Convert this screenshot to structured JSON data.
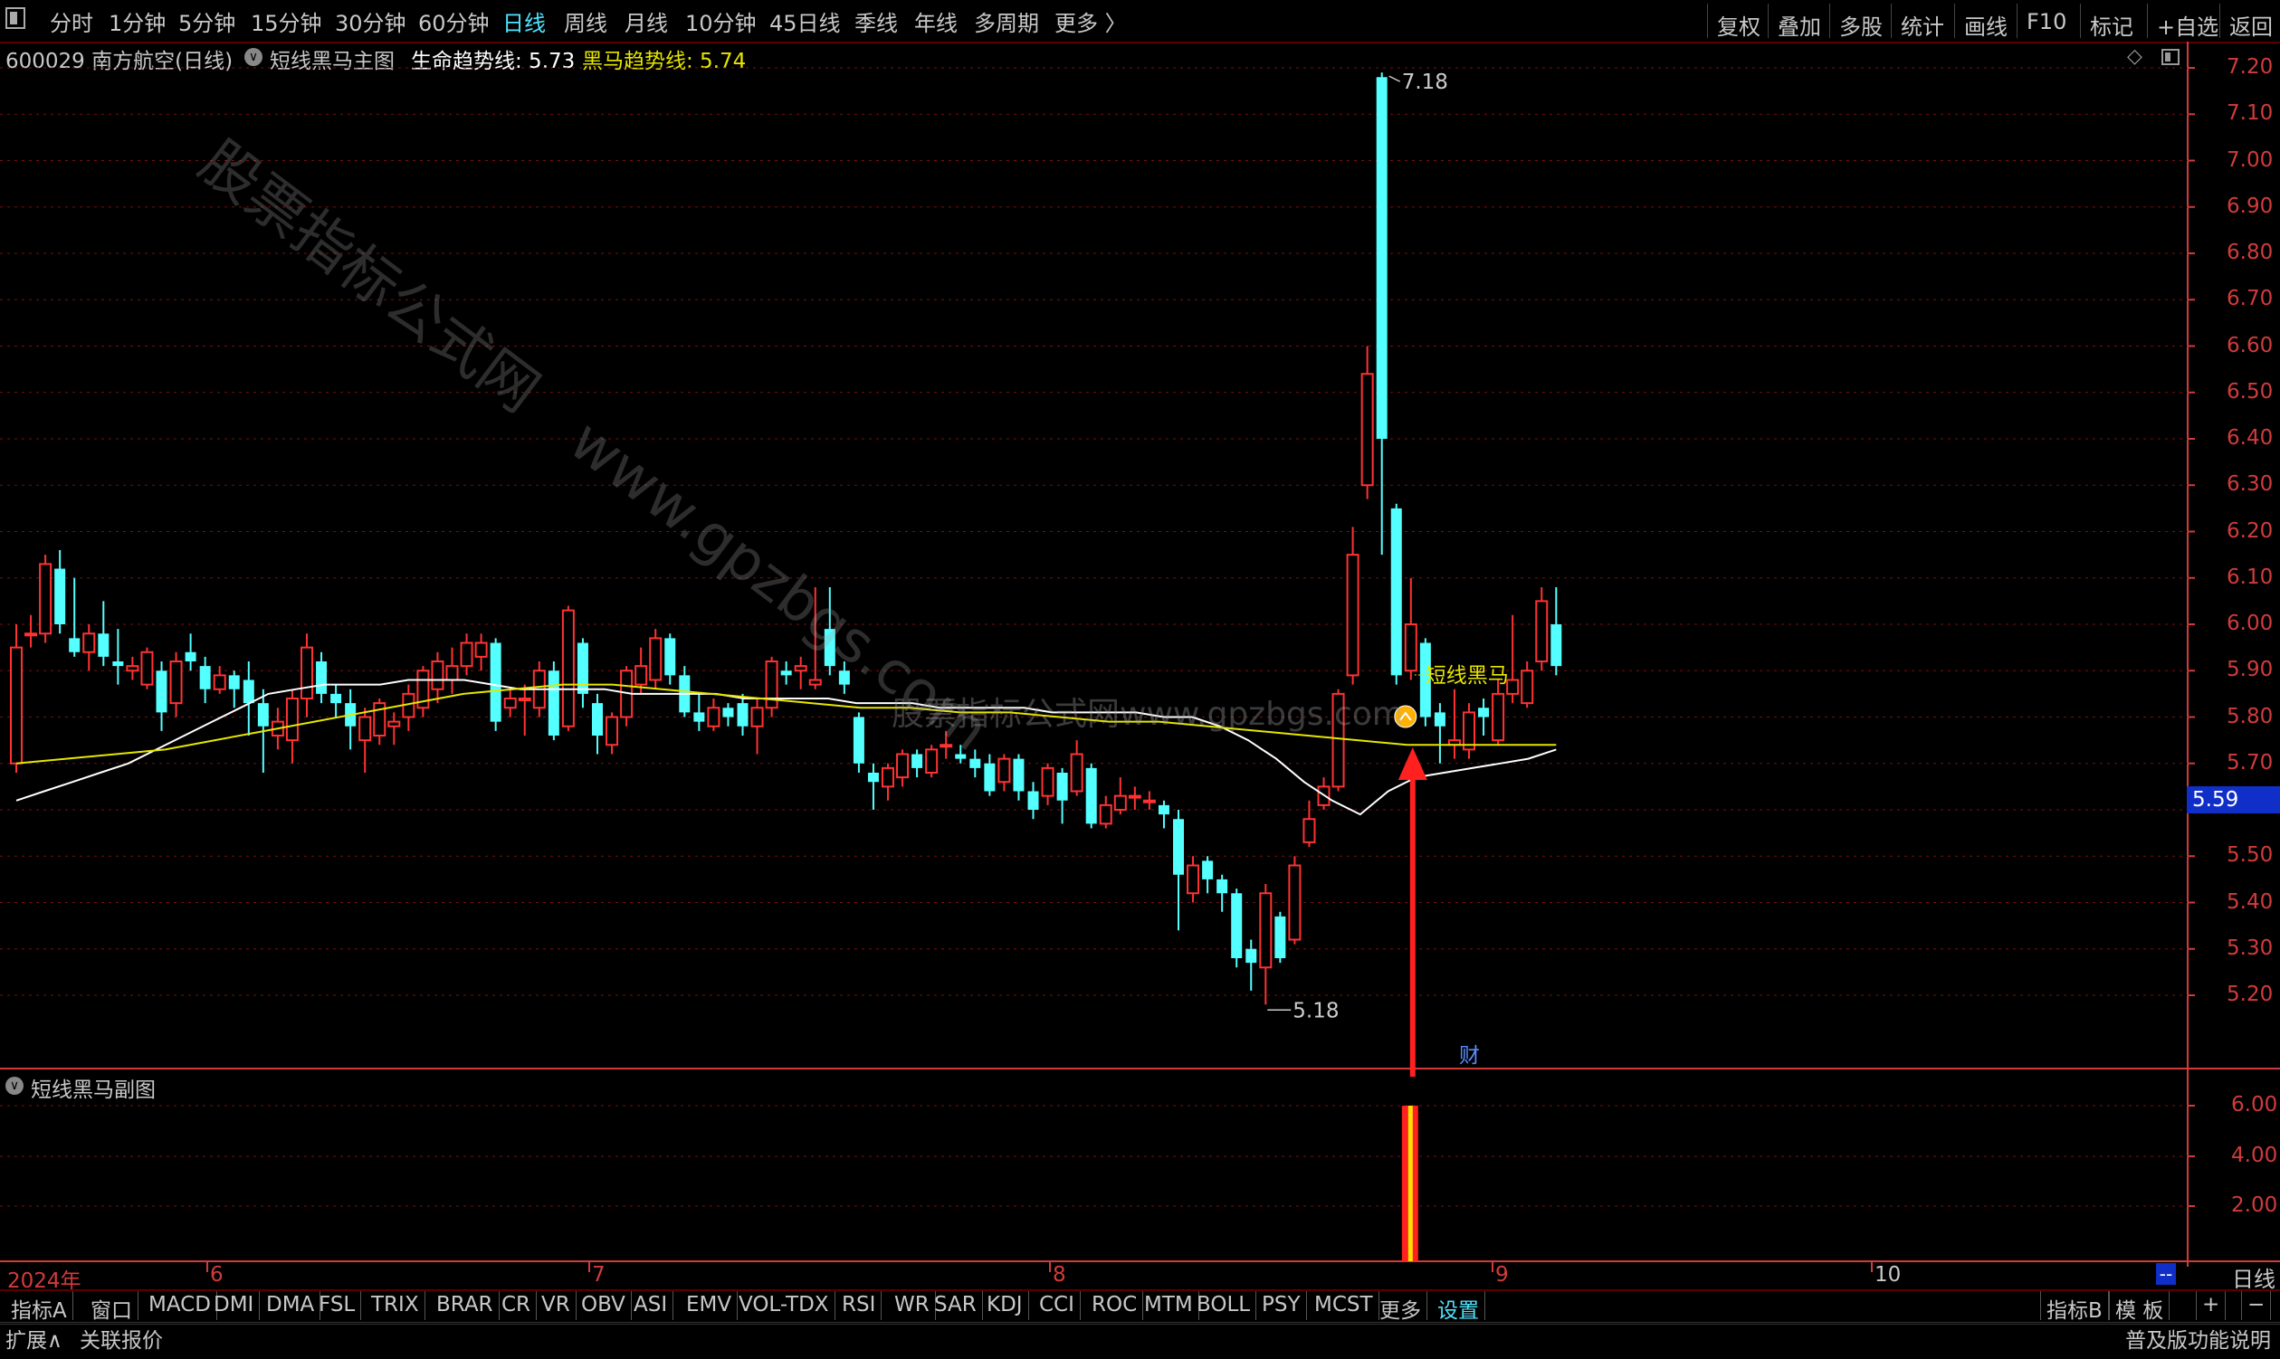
{
  "topbar": {
    "periods": [
      "分时",
      "1分钟",
      "5分钟",
      "15分钟",
      "30分钟",
      "60分钟",
      "日线",
      "周线",
      "月线",
      "10分钟",
      "45日线",
      "季线",
      "年线",
      "多周期",
      "更多 〉"
    ],
    "active_period": "日线",
    "right_buttons": [
      "复权",
      "叠加",
      "多股",
      "统计",
      "画线",
      "F10",
      "标记",
      "+自选",
      "返回"
    ]
  },
  "info": {
    "stock": "600029 南方航空(日线)",
    "indicator_name": "短线黑马主图",
    "life_line_label": "生命趋势线: 5.73",
    "horse_line_label": "黑马趋势线: 5.74"
  },
  "chart": {
    "price_ticks": [
      "7.20",
      "7.10",
      "7.00",
      "6.90",
      "6.80",
      "6.70",
      "6.60",
      "6.50",
      "6.40",
      "6.30",
      "6.20",
      "6.10",
      "6.00",
      "5.90",
      "5.80",
      "5.70",
      "5.50",
      "5.40",
      "5.30",
      "5.20"
    ],
    "current_price": "5.59",
    "high_label": "7.18",
    "low_label": "5.18",
    "signal_label": "短线黑马",
    "fin_marker": "财",
    "watermark_1": "股票指标公式网",
    "watermark_2": "www.gpzbgs.com",
    "watermark_3": "股票指标公式网www.gpzbgs.com",
    "x_ticks": [
      "2024年",
      "6",
      "7",
      "8",
      "9",
      "10"
    ],
    "period_label": "日线",
    "scroll_label": "--"
  },
  "sub_chart": {
    "title": "短线黑马副图",
    "ticks": [
      "6.00",
      "4.00",
      "2.00"
    ]
  },
  "indicator_tabs": [
    "指标A",
    "窗口",
    "MACD",
    "DMI",
    "DMA",
    "FSL",
    "TRIX",
    "BRAR",
    "CR",
    "VR",
    "OBV",
    "ASI",
    "EMV",
    "VOL-TDX",
    "RSI",
    "WR",
    "SAR",
    "KDJ",
    "CCI",
    "ROC",
    "MTM",
    "BOLL",
    "PSY",
    "MCST",
    "更多",
    "设置"
  ],
  "active_tab": "设置",
  "right_tabs": [
    "指标B",
    "模 板",
    "+",
    "−"
  ],
  "footer": {
    "expand": "扩展∧",
    "quote": "关联报价",
    "help": "普及版功能说明"
  },
  "colors": {
    "up": "#ff3232",
    "down": "#54ffff",
    "life_line": "#ffffff",
    "horse_line": "#e6e600",
    "axis": "#d23b3b",
    "grid": "#7a1010",
    "active": "#4fe3ff"
  },
  "chart_data": {
    "type": "candlestick",
    "series": [
      {
        "o": 5.7,
        "c": 5.95,
        "h": 6.0,
        "l": 5.68
      },
      {
        "o": 5.98,
        "c": 5.98,
        "h": 6.02,
        "l": 5.95
      },
      {
        "o": 5.98,
        "c": 6.13,
        "h": 6.15,
        "l": 5.96
      },
      {
        "o": 6.12,
        "c": 6.0,
        "h": 6.16,
        "l": 5.98
      },
      {
        "o": 5.97,
        "c": 5.94,
        "h": 6.1,
        "l": 5.93
      },
      {
        "o": 5.94,
        "c": 5.98,
        "h": 6.0,
        "l": 5.9
      },
      {
        "o": 5.98,
        "c": 5.93,
        "h": 6.05,
        "l": 5.91
      },
      {
        "o": 5.92,
        "c": 5.91,
        "h": 5.99,
        "l": 5.87
      },
      {
        "o": 5.9,
        "c": 5.91,
        "h": 5.93,
        "l": 5.88
      },
      {
        "o": 5.87,
        "c": 5.94,
        "h": 5.95,
        "l": 5.86
      },
      {
        "o": 5.9,
        "c": 5.81,
        "h": 5.92,
        "l": 5.77
      },
      {
        "o": 5.83,
        "c": 5.92,
        "h": 5.94,
        "l": 5.8
      },
      {
        "o": 5.94,
        "c": 5.92,
        "h": 5.98,
        "l": 5.9
      },
      {
        "o": 5.91,
        "c": 5.86,
        "h": 5.93,
        "l": 5.83
      },
      {
        "o": 5.86,
        "c": 5.89,
        "h": 5.91,
        "l": 5.85
      },
      {
        "o": 5.89,
        "c": 5.86,
        "h": 5.9,
        "l": 5.82
      },
      {
        "o": 5.88,
        "c": 5.83,
        "h": 5.92,
        "l": 5.76
      },
      {
        "o": 5.83,
        "c": 5.78,
        "h": 5.86,
        "l": 5.68
      },
      {
        "o": 5.76,
        "c": 5.79,
        "h": 5.82,
        "l": 5.73
      },
      {
        "o": 5.75,
        "c": 5.84,
        "h": 5.86,
        "l": 5.7
      },
      {
        "o": 5.84,
        "c": 5.95,
        "h": 5.98,
        "l": 5.8
      },
      {
        "o": 5.92,
        "c": 5.85,
        "h": 5.94,
        "l": 5.83
      },
      {
        "o": 5.85,
        "c": 5.83,
        "h": 5.87,
        "l": 5.8
      },
      {
        "o": 5.83,
        "c": 5.78,
        "h": 5.86,
        "l": 5.73
      },
      {
        "o": 5.75,
        "c": 5.8,
        "h": 5.82,
        "l": 5.68
      },
      {
        "o": 5.76,
        "c": 5.83,
        "h": 5.84,
        "l": 5.74
      },
      {
        "o": 5.78,
        "c": 5.79,
        "h": 5.81,
        "l": 5.74
      },
      {
        "o": 5.8,
        "c": 5.85,
        "h": 5.87,
        "l": 5.77
      },
      {
        "o": 5.82,
        "c": 5.9,
        "h": 5.91,
        "l": 5.8
      },
      {
        "o": 5.86,
        "c": 5.92,
        "h": 5.94,
        "l": 5.83
      },
      {
        "o": 5.88,
        "c": 5.91,
        "h": 5.95,
        "l": 5.85
      },
      {
        "o": 5.91,
        "c": 5.96,
        "h": 5.98,
        "l": 5.89
      },
      {
        "o": 5.93,
        "c": 5.96,
        "h": 5.98,
        "l": 5.9
      },
      {
        "o": 5.96,
        "c": 5.79,
        "h": 5.97,
        "l": 5.77
      },
      {
        "o": 5.82,
        "c": 5.84,
        "h": 5.86,
        "l": 5.8
      },
      {
        "o": 5.84,
        "c": 5.84,
        "h": 5.87,
        "l": 5.76
      },
      {
        "o": 5.82,
        "c": 5.9,
        "h": 5.92,
        "l": 5.8
      },
      {
        "o": 5.9,
        "c": 5.76,
        "h": 5.92,
        "l": 5.75
      },
      {
        "o": 5.78,
        "c": 6.03,
        "h": 6.04,
        "l": 5.77
      },
      {
        "o": 5.96,
        "c": 5.85,
        "h": 5.97,
        "l": 5.82
      },
      {
        "o": 5.83,
        "c": 5.76,
        "h": 5.85,
        "l": 5.72
      },
      {
        "o": 5.74,
        "c": 5.8,
        "h": 5.81,
        "l": 5.72
      },
      {
        "o": 5.8,
        "c": 5.9,
        "h": 5.91,
        "l": 5.78
      },
      {
        "o": 5.87,
        "c": 5.91,
        "h": 5.95,
        "l": 5.85
      },
      {
        "o": 5.88,
        "c": 5.97,
        "h": 5.99,
        "l": 5.86
      },
      {
        "o": 5.97,
        "c": 5.89,
        "h": 5.98,
        "l": 5.87
      },
      {
        "o": 5.89,
        "c": 5.81,
        "h": 5.91,
        "l": 5.8
      },
      {
        "o": 5.81,
        "c": 5.79,
        "h": 5.85,
        "l": 5.77
      },
      {
        "o": 5.78,
        "c": 5.82,
        "h": 5.84,
        "l": 5.77
      },
      {
        "o": 5.82,
        "c": 5.8,
        "h": 5.83,
        "l": 5.78
      },
      {
        "o": 5.83,
        "c": 5.78,
        "h": 5.85,
        "l": 5.76
      },
      {
        "o": 5.78,
        "c": 5.82,
        "h": 5.84,
        "l": 5.72
      },
      {
        "o": 5.82,
        "c": 5.92,
        "h": 5.93,
        "l": 5.8
      },
      {
        "o": 5.9,
        "c": 5.89,
        "h": 5.92,
        "l": 5.87
      },
      {
        "o": 5.9,
        "c": 5.91,
        "h": 5.93,
        "l": 5.86
      },
      {
        "o": 5.87,
        "c": 5.88,
        "h": 6.08,
        "l": 5.86
      },
      {
        "o": 5.99,
        "c": 5.91,
        "h": 6.08,
        "l": 5.89
      },
      {
        "o": 5.9,
        "c": 5.87,
        "h": 5.92,
        "l": 5.85
      },
      {
        "o": 5.8,
        "c": 5.7,
        "h": 5.81,
        "l": 5.68
      },
      {
        "o": 5.68,
        "c": 5.66,
        "h": 5.7,
        "l": 5.6
      },
      {
        "o": 5.65,
        "c": 5.69,
        "h": 5.7,
        "l": 5.62
      },
      {
        "o": 5.67,
        "c": 5.72,
        "h": 5.73,
        "l": 5.65
      },
      {
        "o": 5.72,
        "c": 5.69,
        "h": 5.73,
        "l": 5.67
      },
      {
        "o": 5.68,
        "c": 5.73,
        "h": 5.74,
        "l": 5.67
      },
      {
        "o": 5.74,
        "c": 5.74,
        "h": 5.77,
        "l": 5.71
      },
      {
        "o": 5.72,
        "c": 5.71,
        "h": 5.74,
        "l": 5.7
      },
      {
        "o": 5.71,
        "c": 5.69,
        "h": 5.73,
        "l": 5.67
      },
      {
        "o": 5.7,
        "c": 5.64,
        "h": 5.72,
        "l": 5.63
      },
      {
        "o": 5.66,
        "c": 5.71,
        "h": 5.72,
        "l": 5.64
      },
      {
        "o": 5.71,
        "c": 5.64,
        "h": 5.72,
        "l": 5.62
      },
      {
        "o": 5.64,
        "c": 5.6,
        "h": 5.66,
        "l": 5.58
      },
      {
        "o": 5.63,
        "c": 5.69,
        "h": 5.7,
        "l": 5.61
      },
      {
        "o": 5.68,
        "c": 5.62,
        "h": 5.69,
        "l": 5.57
      },
      {
        "o": 5.64,
        "c": 5.72,
        "h": 5.75,
        "l": 5.63
      },
      {
        "o": 5.69,
        "c": 5.57,
        "h": 5.7,
        "l": 5.56
      },
      {
        "o": 5.57,
        "c": 5.61,
        "h": 5.63,
        "l": 5.56
      },
      {
        "o": 5.6,
        "c": 5.63,
        "h": 5.67,
        "l": 5.59
      },
      {
        "o": 5.63,
        "c": 5.63,
        "h": 5.65,
        "l": 5.6
      },
      {
        "o": 5.62,
        "c": 5.62,
        "h": 5.64,
        "l": 5.6
      },
      {
        "o": 5.61,
        "c": 5.59,
        "h": 5.62,
        "l": 5.56
      },
      {
        "o": 5.58,
        "c": 5.46,
        "h": 5.6,
        "l": 5.34
      },
      {
        "o": 5.42,
        "c": 5.48,
        "h": 5.5,
        "l": 5.4
      },
      {
        "o": 5.49,
        "c": 5.45,
        "h": 5.5,
        "l": 5.42
      },
      {
        "o": 5.45,
        "c": 5.42,
        "h": 5.46,
        "l": 5.38
      },
      {
        "o": 5.42,
        "c": 5.28,
        "h": 5.43,
        "l": 5.26
      },
      {
        "o": 5.3,
        "c": 5.27,
        "h": 5.32,
        "l": 5.21
      },
      {
        "o": 5.26,
        "c": 5.42,
        "h": 5.44,
        "l": 5.18
      },
      {
        "o": 5.37,
        "c": 5.28,
        "h": 5.38,
        "l": 5.27
      },
      {
        "o": 5.32,
        "c": 5.48,
        "h": 5.5,
        "l": 5.31
      },
      {
        "o": 5.53,
        "c": 5.58,
        "h": 5.62,
        "l": 5.52
      },
      {
        "o": 5.61,
        "c": 5.65,
        "h": 5.67,
        "l": 5.6
      },
      {
        "o": 5.65,
        "c": 5.85,
        "h": 5.86,
        "l": 5.64
      },
      {
        "o": 5.89,
        "c": 6.15,
        "h": 6.21,
        "l": 5.87
      },
      {
        "o": 6.3,
        "c": 6.54,
        "h": 6.6,
        "l": 6.27
      },
      {
        "o": 7.18,
        "c": 6.4,
        "h": 7.19,
        "l": 6.15
      },
      {
        "o": 6.25,
        "c": 5.89,
        "h": 6.26,
        "l": 5.87
      },
      {
        "o": 5.9,
        "c": 6.0,
        "h": 6.1,
        "l": 5.88
      },
      {
        "o": 5.96,
        "c": 5.8,
        "h": 5.97,
        "l": 5.78
      },
      {
        "o": 5.81,
        "c": 5.78,
        "h": 5.83,
        "l": 5.7
      },
      {
        "o": 5.74,
        "c": 5.75,
        "h": 5.86,
        "l": 5.71
      },
      {
        "o": 5.73,
        "c": 5.81,
        "h": 5.83,
        "l": 5.71
      },
      {
        "o": 5.82,
        "c": 5.8,
        "h": 5.84,
        "l": 5.76
      },
      {
        "o": 5.75,
        "c": 5.85,
        "h": 5.88,
        "l": 5.74
      },
      {
        "o": 5.85,
        "c": 5.88,
        "h": 6.02,
        "l": 5.83
      },
      {
        "o": 5.83,
        "c": 5.9,
        "h": 5.92,
        "l": 5.82
      },
      {
        "o": 5.92,
        "c": 6.05,
        "h": 6.08,
        "l": 5.9
      },
      {
        "o": 6.0,
        "c": 5.91,
        "h": 6.08,
        "l": 5.89
      }
    ],
    "life_line": [
      5.62,
      5.64,
      5.66,
      5.68,
      5.7,
      5.73,
      5.76,
      5.79,
      5.82,
      5.85,
      5.86,
      5.87,
      5.87,
      5.87,
      5.88,
      5.88,
      5.88,
      5.87,
      5.86,
      5.86,
      5.86,
      5.86,
      5.85,
      5.85,
      5.85,
      5.85,
      5.84,
      5.84,
      5.84,
      5.84,
      5.83,
      5.83,
      5.83,
      5.82,
      5.82,
      5.82,
      5.82,
      5.81,
      5.81,
      5.81,
      5.81,
      5.8,
      5.8,
      5.78,
      5.75,
      5.71,
      5.66,
      5.62,
      5.59,
      5.64,
      5.67,
      5.68,
      5.69,
      5.7,
      5.71,
      5.73
    ],
    "horse_line": [
      5.7,
      5.71,
      5.72,
      5.73,
      5.75,
      5.77,
      5.79,
      5.81,
      5.83,
      5.85,
      5.86,
      5.87,
      5.87,
      5.86,
      5.85,
      5.84,
      5.83,
      5.82,
      5.82,
      5.81,
      5.81,
      5.8,
      5.79,
      5.79,
      5.78,
      5.77,
      5.76,
      5.75,
      5.74,
      5.74,
      5.74,
      5.74
    ],
    "sub_signal": {
      "index": 96,
      "value": 6.0
    },
    "ylim": [
      5.1,
      7.22
    ]
  }
}
